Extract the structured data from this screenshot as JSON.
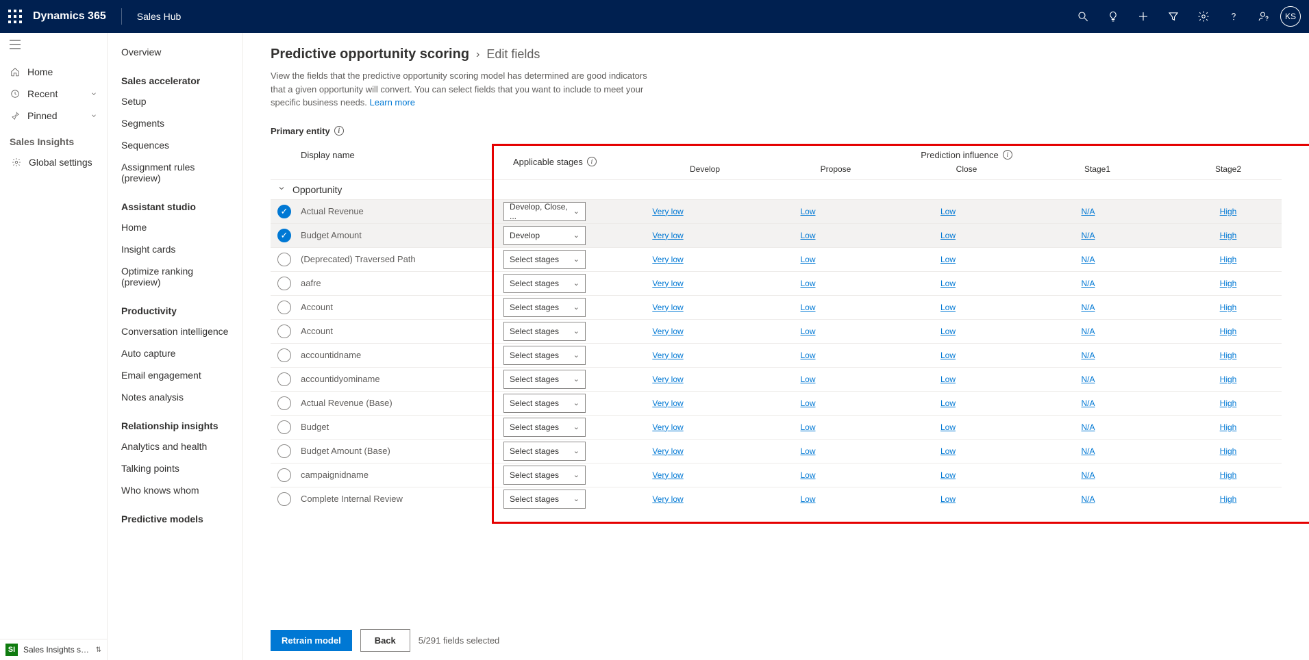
{
  "topbar": {
    "product": "Dynamics 365",
    "app": "Sales Hub",
    "avatar": "KS"
  },
  "left_nav": {
    "home": "Home",
    "recent": "Recent",
    "pinned": "Pinned",
    "header1": "Sales Insights",
    "global_settings": "Global settings",
    "area_badge": "SI",
    "area_text": "Sales Insights sett..."
  },
  "sec_nav": {
    "overview": "Overview",
    "groups": [
      {
        "title": "Sales accelerator",
        "items": [
          "Setup",
          "Segments",
          "Sequences",
          "Assignment rules (preview)"
        ]
      },
      {
        "title": "Assistant studio",
        "items": [
          "Home",
          "Insight cards",
          "Optimize ranking (preview)"
        ]
      },
      {
        "title": "Productivity",
        "items": [
          "Conversation intelligence",
          "Auto capture",
          "Email engagement",
          "Notes analysis"
        ]
      },
      {
        "title": "Relationship insights",
        "items": [
          "Analytics and health",
          "Talking points",
          "Who knows whom"
        ]
      },
      {
        "title": "Predictive models",
        "items": []
      }
    ]
  },
  "content": {
    "breadcrumb_main": "Predictive opportunity scoring",
    "breadcrumb_sub": "Edit fields",
    "description": "View the fields that the predictive opportunity scoring model has determined are good indicators that a given opportunity will convert. You can select fields that you want to include to meet your specific business needs.",
    "learn_more": "Learn more",
    "primary_entity": "Primary entity",
    "col_display": "Display name",
    "col_stages": "Applicable stages",
    "col_influence": "Prediction influence",
    "stages": [
      "Develop",
      "Propose",
      "Close",
      "Stage1",
      "Stage2"
    ],
    "entity_label": "Opportunity",
    "rows": [
      {
        "checked": true,
        "display": "Actual Revenue",
        "stage_sel": "Develop, Close, ...",
        "inf": [
          "Very low",
          "Low",
          "Low",
          "N/A",
          "High"
        ]
      },
      {
        "checked": true,
        "display": "Budget Amount",
        "stage_sel": "Develop",
        "inf": [
          "Very low",
          "Low",
          "Low",
          "N/A",
          "High"
        ]
      },
      {
        "checked": false,
        "display": "(Deprecated) Traversed Path",
        "stage_sel": "Select stages",
        "inf": [
          "Very low",
          "Low",
          "Low",
          "N/A",
          "High"
        ]
      },
      {
        "checked": false,
        "display": "aafre",
        "stage_sel": "Select stages",
        "inf": [
          "Very low",
          "Low",
          "Low",
          "N/A",
          "High"
        ]
      },
      {
        "checked": false,
        "display": "Account",
        "stage_sel": "Select stages",
        "inf": [
          "Very low",
          "Low",
          "Low",
          "N/A",
          "High"
        ]
      },
      {
        "checked": false,
        "display": "Account",
        "stage_sel": "Select stages",
        "inf": [
          "Very low",
          "Low",
          "Low",
          "N/A",
          "High"
        ]
      },
      {
        "checked": false,
        "display": "accountidname",
        "stage_sel": "Select stages",
        "inf": [
          "Very low",
          "Low",
          "Low",
          "N/A",
          "High"
        ]
      },
      {
        "checked": false,
        "display": "accountidyominame",
        "stage_sel": "Select stages",
        "inf": [
          "Very low",
          "Low",
          "Low",
          "N/A",
          "High"
        ]
      },
      {
        "checked": false,
        "display": "Actual Revenue (Base)",
        "stage_sel": "Select stages",
        "inf": [
          "Very low",
          "Low",
          "Low",
          "N/A",
          "High"
        ]
      },
      {
        "checked": false,
        "display": "Budget",
        "stage_sel": "Select stages",
        "inf": [
          "Very low",
          "Low",
          "Low",
          "N/A",
          "High"
        ]
      },
      {
        "checked": false,
        "display": "Budget Amount (Base)",
        "stage_sel": "Select stages",
        "inf": [
          "Very low",
          "Low",
          "Low",
          "N/A",
          "High"
        ]
      },
      {
        "checked": false,
        "display": "campaignidname",
        "stage_sel": "Select stages",
        "inf": [
          "Very low",
          "Low",
          "Low",
          "N/A",
          "High"
        ]
      },
      {
        "checked": false,
        "display": "Complete Internal Review",
        "stage_sel": "Select stages",
        "inf": [
          "Very low",
          "Low",
          "Low",
          "N/A",
          "High"
        ]
      }
    ],
    "retrain": "Retrain model",
    "back": "Back",
    "status": "5/291 fields selected"
  }
}
